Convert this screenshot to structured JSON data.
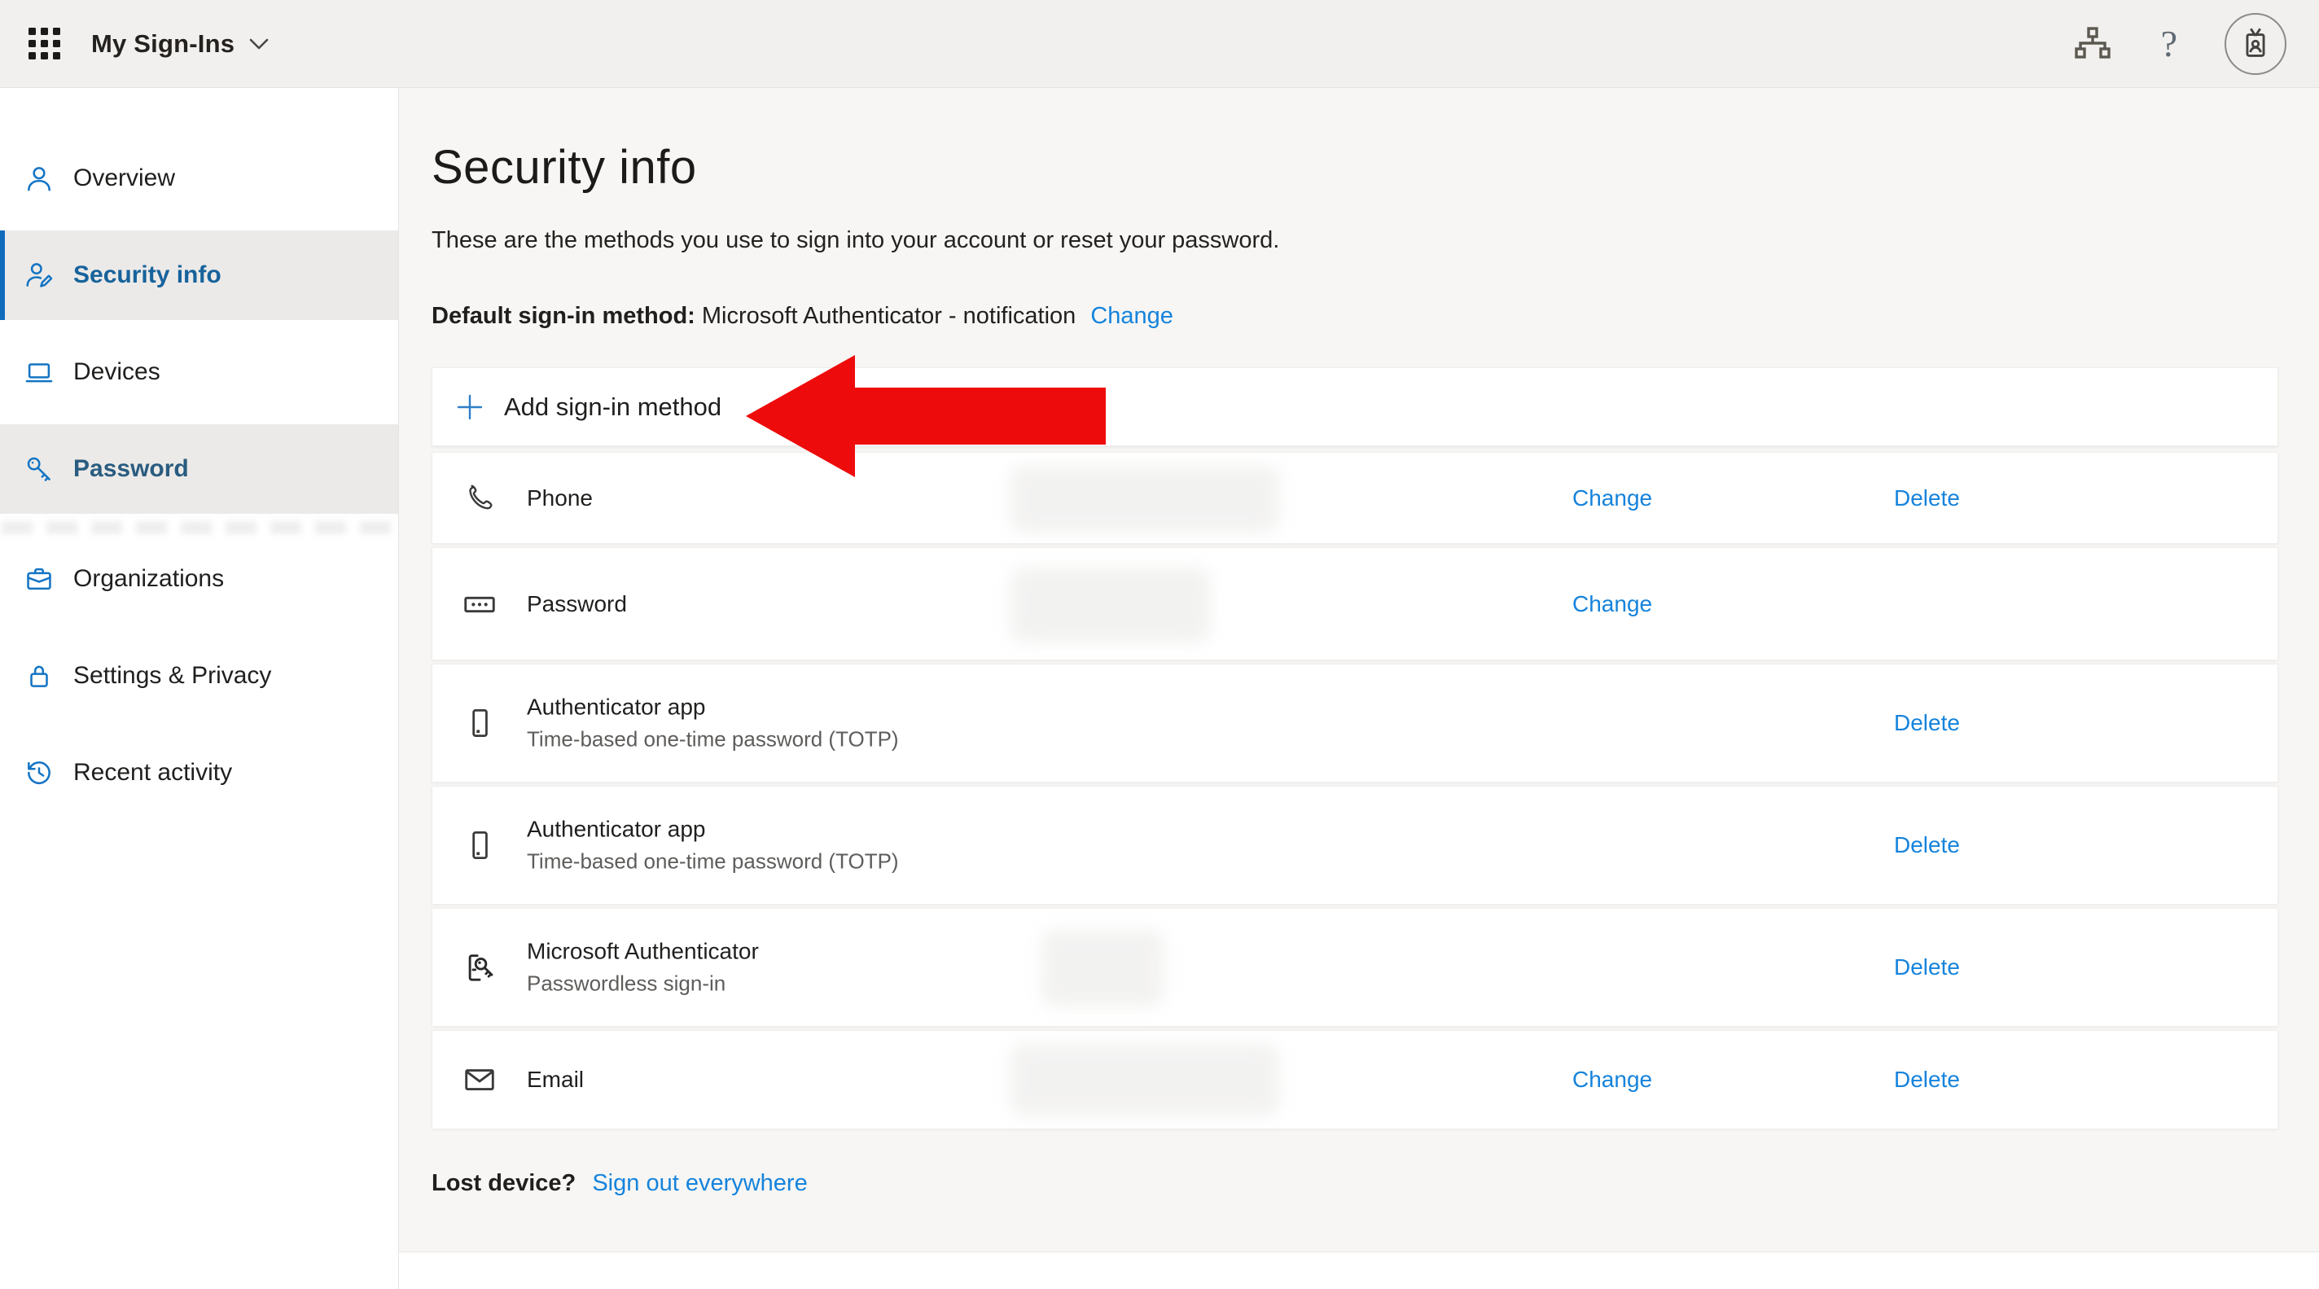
{
  "topbar": {
    "title": "My Sign-Ins"
  },
  "sidebar": {
    "items": [
      {
        "label": "Overview",
        "icon": "person-icon",
        "state": "normal"
      },
      {
        "label": "Security info",
        "icon": "person-edit-icon",
        "state": "selected"
      },
      {
        "label": "Devices",
        "icon": "laptop-icon",
        "state": "normal"
      },
      {
        "label": "Password",
        "icon": "key-icon",
        "state": "hover"
      },
      {
        "label": "Organizations",
        "icon": "briefcase-icon",
        "state": "normal"
      },
      {
        "label": "Settings & Privacy",
        "icon": "lock-icon",
        "state": "normal"
      },
      {
        "label": "Recent activity",
        "icon": "history-icon",
        "state": "normal"
      }
    ]
  },
  "main": {
    "title": "Security info",
    "description": "These are the methods you use to sign into your account or reset your password.",
    "default_method_label": "Default sign-in method:",
    "default_method_value": "Microsoft Authenticator - notification",
    "add_button": "Add sign-in method",
    "actions": {
      "change": "Change",
      "delete": "Delete"
    },
    "methods": [
      {
        "title": "Phone",
        "subtitle": "",
        "icon": "phone-handset-icon",
        "actions": [
          "change",
          "delete"
        ],
        "value_redacted": true
      },
      {
        "title": "Password",
        "subtitle": "",
        "icon": "password-dots-icon",
        "actions": [
          "change"
        ],
        "value_redacted": true
      },
      {
        "title": "Authenticator app",
        "subtitle": "Time-based one-time password (TOTP)",
        "icon": "smartphone-icon",
        "actions": [
          "delete"
        ],
        "value_redacted": false
      },
      {
        "title": "Authenticator app",
        "subtitle": "Time-based one-time password (TOTP)",
        "icon": "smartphone-icon",
        "actions": [
          "delete"
        ],
        "value_redacted": false
      },
      {
        "title": "Microsoft Authenticator",
        "subtitle": "Passwordless sign-in",
        "icon": "authenticator-key-icon",
        "actions": [
          "delete"
        ],
        "value_redacted": true
      },
      {
        "title": "Email",
        "subtitle": "",
        "icon": "envelope-icon",
        "actions": [
          "change",
          "delete"
        ],
        "value_redacted": true
      }
    ],
    "footer": {
      "lost_label": "Lost device?",
      "signout_link": "Sign out everywhere"
    }
  },
  "icons": {
    "app_launcher": "waffle-grid",
    "title_chevron": "chevron-down",
    "org_chart": "sitemap",
    "help": "?",
    "account": "id-badge",
    "add": "+"
  },
  "colors": {
    "accent_blue": "#0f6cbd",
    "sidebar_icon_blue": "#1474c4",
    "link_blue": "#1583dc",
    "arrow_red": "#ee0b0b",
    "topbar_bg": "#f1f0ee",
    "content_bg": "#f7f6f4",
    "selected_item_bg": "#eceae8"
  }
}
